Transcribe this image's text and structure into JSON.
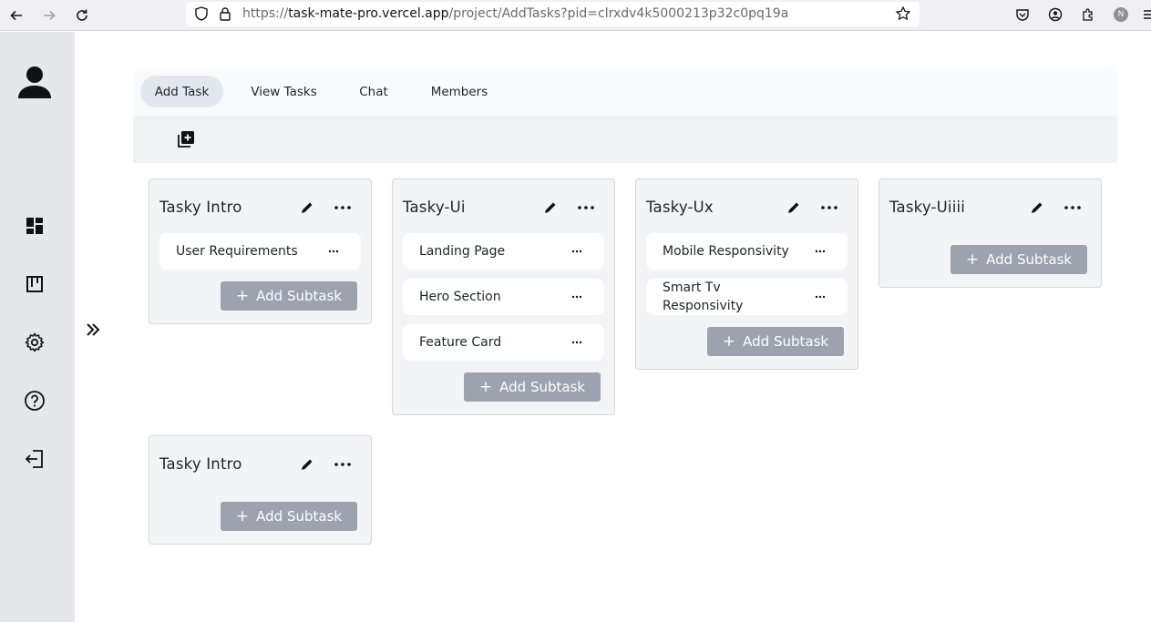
{
  "browser": {
    "url_prefix": "https://",
    "url_host": "task-mate-pro.vercel.app",
    "url_path": "/project/AddTasks?pid=clrxdv4k5000213p32c0pq19a",
    "profile_initial": "N"
  },
  "tabs": [
    {
      "label": "Add Task",
      "active": true
    },
    {
      "label": "View Tasks",
      "active": false
    },
    {
      "label": "Chat",
      "active": false
    },
    {
      "label": "Members",
      "active": false
    }
  ],
  "columns": [
    {
      "title": "Tasky Intro",
      "subtasks": [
        "User Requirements"
      ],
      "add_label": "Add Subtask"
    },
    {
      "title": "Tasky-Ui",
      "subtasks": [
        "Landing Page",
        "Hero Section",
        "Feature Card"
      ],
      "add_label": "Add Subtask"
    },
    {
      "title": "Tasky-Ux",
      "subtasks": [
        "Mobile Responsivity",
        "Smart Tv Responsivity"
      ],
      "add_label": "Add Subtask"
    },
    {
      "title": "Tasky-Uiiii",
      "subtasks": [],
      "add_label": "Add Subtask"
    },
    {
      "title": "Tasky Intro",
      "subtasks": [],
      "add_label": "Add Subtask"
    }
  ],
  "subtask_more_glyph": "···",
  "plus_glyph": "+",
  "colors": {
    "sidebar_bg": "#e5e7eb",
    "active_tab_bg": "#e2e8f0",
    "column_bg": "#f3f4f6",
    "add_button_bg": "#9ca3af"
  },
  "icons": {
    "sidebar": [
      "user-icon",
      "dashboard-icon",
      "kanban-icon",
      "settings-icon",
      "help-icon",
      "logout-icon"
    ],
    "expand": "double-chevron-right-icon",
    "toolbar": "add-column-icon"
  }
}
